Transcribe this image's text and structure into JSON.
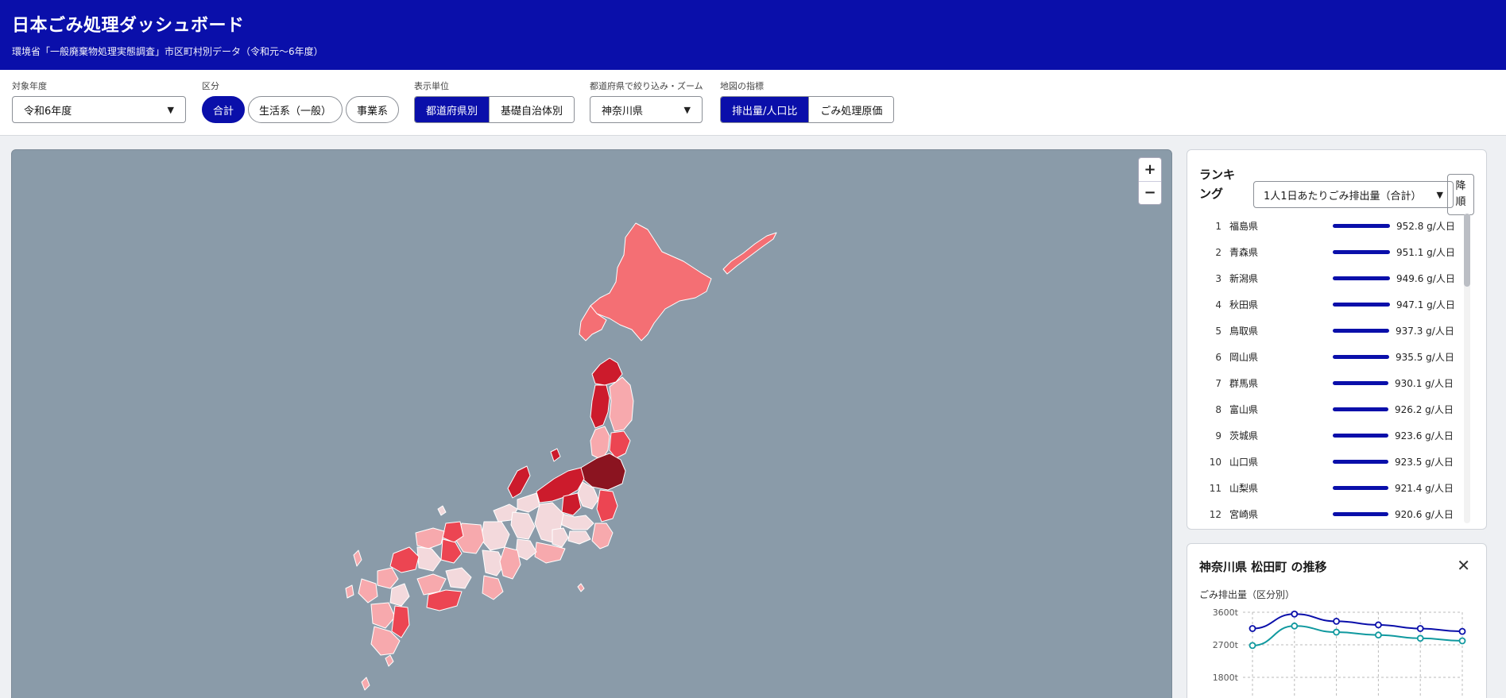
{
  "header": {
    "title": "日本ごみ処理ダッシュボード",
    "subtitle": "環境省「一般廃棄物処理実態調査」市区町村別データ（令和元〜6年度）"
  },
  "controls": {
    "year": {
      "label": "対象年度",
      "value": "令和6年度"
    },
    "category": {
      "label": "区分",
      "options": [
        "合計",
        "生活系（一般）",
        "事業系"
      ],
      "selected": "合計"
    },
    "unit": {
      "label": "表示単位",
      "options": [
        "都道府県別",
        "基礎自治体別"
      ],
      "selected": "都道府県別"
    },
    "prefecture": {
      "label": "都道府県で絞り込み・ズーム",
      "value": "神奈川県"
    },
    "metric": {
      "label": "地図の指標",
      "options": [
        "排出量/人口比",
        "ごみ処理原価"
      ],
      "selected": "排出量/人口比"
    }
  },
  "map": {
    "zoom_in": "+",
    "zoom_out": "−",
    "colors": {
      "water": "#8a9ba9",
      "darkest": "#8b1420",
      "dark": "#cc1b2c",
      "mid": "#ec4552",
      "light": "#f46f74",
      "pale": "#f7a9ad",
      "palest": "#f3d9dc"
    }
  },
  "ranking": {
    "title": "ランキング",
    "metric": "1人1日あたりごみ排出量（合計）",
    "order": "降順",
    "rows": [
      {
        "rank": "1",
        "name": "福島県",
        "value": "952.8 g/人日",
        "ratio": 1.0
      },
      {
        "rank": "2",
        "name": "青森県",
        "value": "951.1 g/人日",
        "ratio": 0.998
      },
      {
        "rank": "3",
        "name": "新潟県",
        "value": "949.6 g/人日",
        "ratio": 0.997
      },
      {
        "rank": "4",
        "name": "秋田県",
        "value": "947.1 g/人日",
        "ratio": 0.994
      },
      {
        "rank": "5",
        "name": "鳥取県",
        "value": "937.3 g/人日",
        "ratio": 0.984
      },
      {
        "rank": "6",
        "name": "岡山県",
        "value": "935.5 g/人日",
        "ratio": 0.982
      },
      {
        "rank": "7",
        "name": "群馬県",
        "value": "930.1 g/人日",
        "ratio": 0.976
      },
      {
        "rank": "8",
        "name": "富山県",
        "value": "926.2 g/人日",
        "ratio": 0.972
      },
      {
        "rank": "9",
        "name": "茨城県",
        "value": "923.6 g/人日",
        "ratio": 0.969
      },
      {
        "rank": "10",
        "name": "山口県",
        "value": "923.5 g/人日",
        "ratio": 0.969
      },
      {
        "rank": "11",
        "name": "山梨県",
        "value": "921.4 g/人日",
        "ratio": 0.967
      },
      {
        "rank": "12",
        "name": "宮崎県",
        "value": "920.6 g/人日",
        "ratio": 0.966
      }
    ]
  },
  "trend": {
    "title": "神奈川県 松田町 の推移",
    "close": "✕",
    "chart_title": "ごみ排出量（区分別）",
    "chart_data": {
      "type": "line",
      "x": [
        1,
        2,
        3,
        4,
        5,
        6
      ],
      "yticks": [
        "3600t",
        "2700t",
        "1800t"
      ],
      "ytick_values": [
        3600,
        2700,
        1800
      ],
      "ylim": [
        1800,
        3600
      ],
      "series": [
        {
          "color": "#0a0faa",
          "values": [
            3150,
            3550,
            3350,
            3250,
            3150,
            3070
          ]
        },
        {
          "color": "#10999f",
          "values": [
            2680,
            3220,
            3050,
            2970,
            2880,
            2810
          ]
        }
      ]
    }
  }
}
